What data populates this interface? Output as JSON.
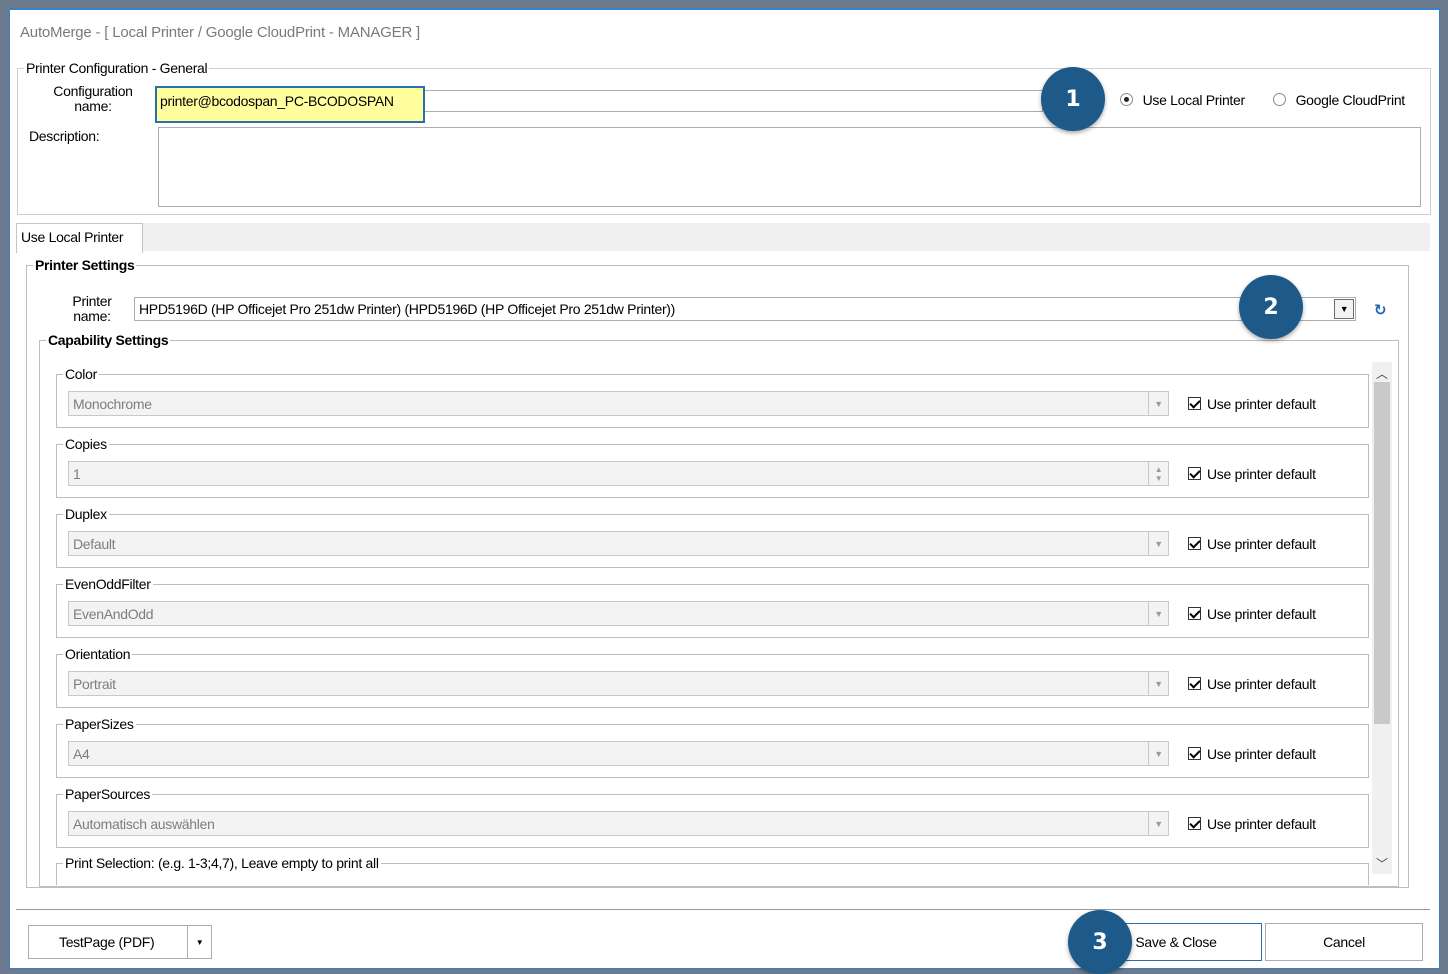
{
  "window": {
    "title": "AutoMerge - [ Local Printer / Google CloudPrint - MANAGER ]"
  },
  "general": {
    "legend": "Printer Configuration - General",
    "config_name_label": "Configuration name:",
    "config_name_value": "printer@bcodospan_PC-BCODOSPAN",
    "description_label": "Description:",
    "description_value": "",
    "radio_local": "Use Local Printer",
    "radio_cloud": "Google CloudPrint",
    "selected": "Use Local Printer"
  },
  "tabs": [
    {
      "label": "Use Local Printer"
    }
  ],
  "printer_settings": {
    "legend": "Printer Settings",
    "printer_name_label": "Printer name:",
    "printer_name_value": "HPD5196D (HP Officejet Pro 251dw Printer) (HPD5196D (HP Officejet Pro 251dw Printer))"
  },
  "capability": {
    "legend": "Capability Settings",
    "default_label": "Use printer default",
    "groups": [
      {
        "name": "Color",
        "value": "Monochrome",
        "kind": "combo"
      },
      {
        "name": "Copies",
        "value": "1",
        "kind": "spin"
      },
      {
        "name": "Duplex",
        "value": "Default",
        "kind": "combo"
      },
      {
        "name": "EvenOddFilter",
        "value": "EvenAndOdd",
        "kind": "combo"
      },
      {
        "name": "Orientation",
        "value": "Portrait",
        "kind": "combo"
      },
      {
        "name": "PaperSizes",
        "value": "A4",
        "kind": "combo"
      },
      {
        "name": "PaperSources",
        "value": "Automatisch auswählen",
        "kind": "combo"
      }
    ],
    "print_selection_legend": "Print Selection: (e.g. 1-3;4,7), Leave empty to print all"
  },
  "footer": {
    "testpage_label": "TestPage (PDF)",
    "save_label": "Save & Close",
    "cancel_label": "Cancel"
  },
  "badges": [
    "1",
    "2",
    "3"
  ],
  "colors": {
    "accent": "#1d5a8a",
    "highlight_field": "#ffff9e",
    "window_border": "#3b7fc4"
  }
}
